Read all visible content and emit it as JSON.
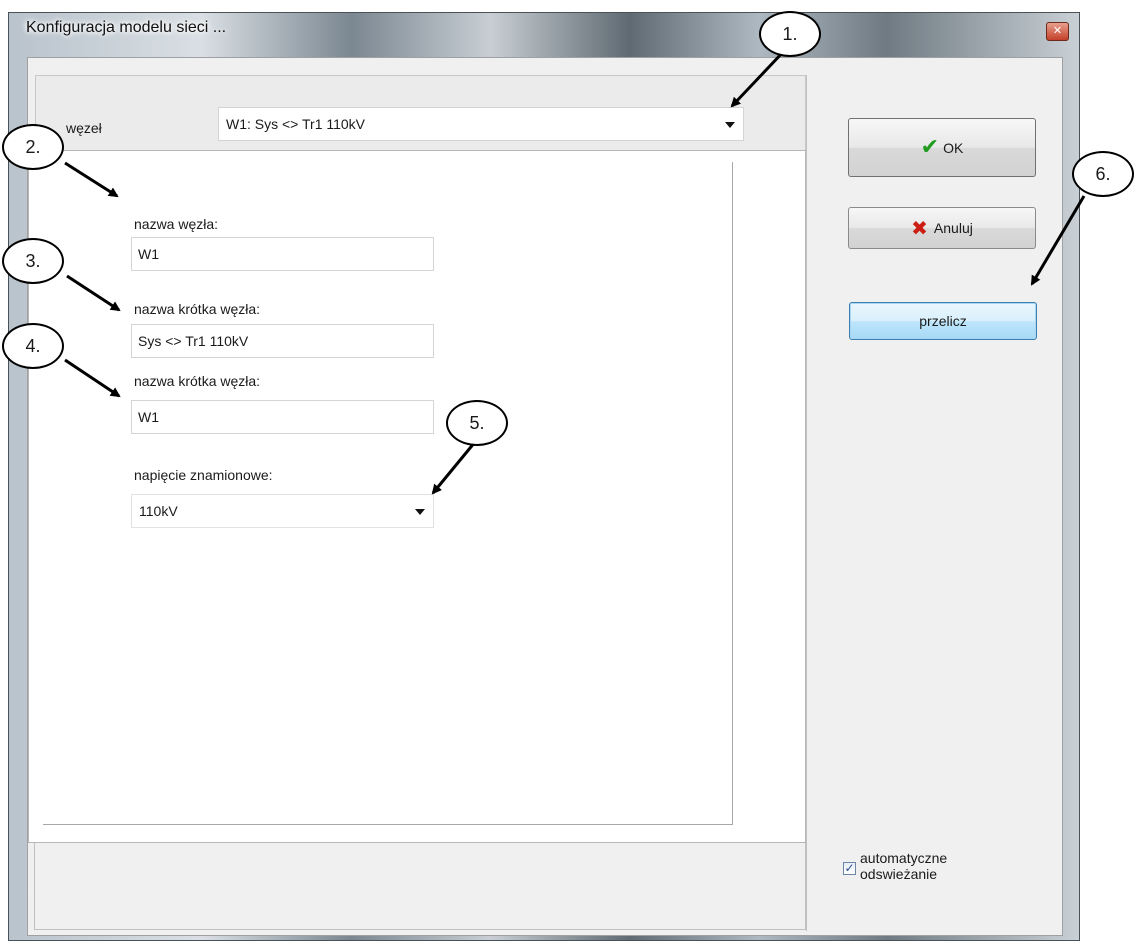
{
  "window": {
    "title": "Konfiguracja modelu sieci ...",
    "close_glyph": "✕"
  },
  "node": {
    "label": "węzeł",
    "selected": "W1: Sys <> Tr1 110kV"
  },
  "fields": [
    {
      "label": "nazwa węzła:",
      "value": "W1"
    },
    {
      "label": "nazwa krótka węzła:",
      "value": "Sys <> Tr1 110kV"
    },
    {
      "label": "nazwa krótka węzła:",
      "value": "W1"
    }
  ],
  "voltage": {
    "label": "napięcie znamionowe:",
    "selected": "110kV"
  },
  "buttons": {
    "ok": "OK",
    "cancel": "Anuluj",
    "recalc": "przelicz"
  },
  "auto_refresh": {
    "line1": "automatyczne",
    "line2": "odswieżanie",
    "checked": true,
    "glyph": "✓"
  },
  "icons": {
    "ok": "check-icon",
    "cancel": "x-icon",
    "dropdown": "chevron-down-icon",
    "close": "close-icon"
  },
  "callouts": [
    "1.",
    "2.",
    "3.",
    "4.",
    "5.",
    "6."
  ],
  "colors": {
    "ok_check": "#1f9b1f",
    "cancel_x": "#cc1e14",
    "focus_button": "#bee6fd"
  }
}
